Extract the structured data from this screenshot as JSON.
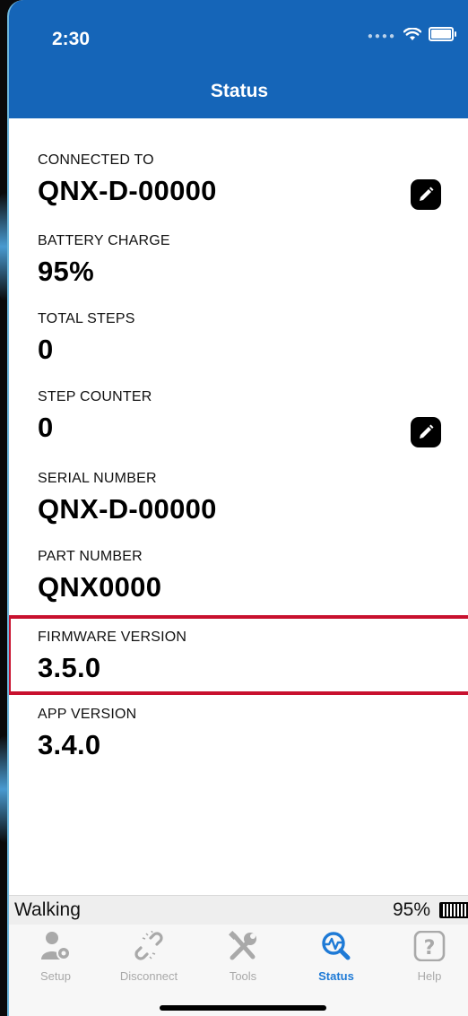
{
  "statusbar": {
    "time": "2:30"
  },
  "header": {
    "title": "Status"
  },
  "fields": [
    {
      "label": "CONNECTED TO",
      "value": "QNX-D-00000",
      "editable": true
    },
    {
      "label": "BATTERY CHARGE",
      "value": "95%",
      "editable": false
    },
    {
      "label": "TOTAL STEPS",
      "value": "0",
      "editable": false
    },
    {
      "label": "STEP COUNTER",
      "value": "0",
      "editable": true
    },
    {
      "label": "SERIAL NUMBER",
      "value": "QNX-D-00000",
      "editable": false
    },
    {
      "label": "PART NUMBER",
      "value": "QNX0000",
      "editable": false
    },
    {
      "label": "FIRMWARE VERSION",
      "value": "3.5.0",
      "editable": false,
      "highlighted": true
    },
    {
      "label": "APP VERSION",
      "value": "3.4.0",
      "editable": false
    }
  ],
  "activity_bar": {
    "mode": "Walking",
    "battery": "95%"
  },
  "tabs": [
    {
      "label": "Setup",
      "icon": "user-gear-icon",
      "active": false
    },
    {
      "label": "Disconnect",
      "icon": "broken-link-icon",
      "active": false
    },
    {
      "label": "Tools",
      "icon": "tools-icon",
      "active": false
    },
    {
      "label": "Status",
      "icon": "status-search-icon",
      "active": true
    },
    {
      "label": "Help",
      "icon": "help-icon",
      "active": false
    }
  ],
  "colors": {
    "header": "#1565b8",
    "active_tab": "#1e7ad6",
    "highlight": "#c8102e"
  }
}
